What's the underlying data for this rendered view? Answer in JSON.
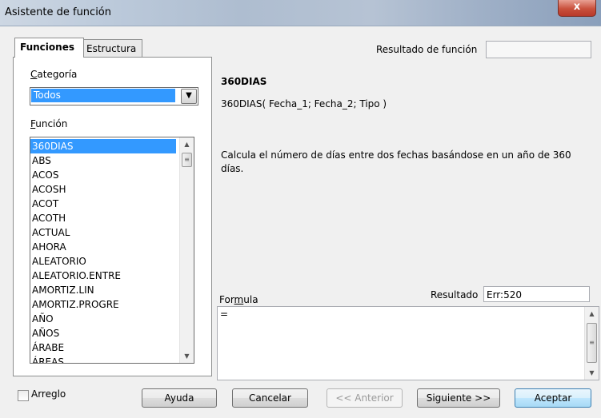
{
  "window": {
    "title": "Asistente de función",
    "close_symbol": "x"
  },
  "tabs": [
    {
      "label": "Funciones",
      "active": true
    },
    {
      "label": "Estructura",
      "active": false
    }
  ],
  "category": {
    "label": "Categoría",
    "selected": "Todos"
  },
  "function_list": {
    "label": "Función",
    "items": [
      "360DIAS",
      "ABS",
      "ACOS",
      "ACOSH",
      "ACOT",
      "ACOTH",
      "ACTUAL",
      "AHORA",
      "ALEATORIO",
      "ALEATORIO.ENTRE",
      "AMORTIZ.LIN",
      "AMORTIZ.PROGRE",
      "AÑO",
      "AÑOS",
      "ÁRABE",
      "ÁREAS"
    ],
    "selected_index": 0
  },
  "function_result": {
    "label": "Resultado de función",
    "value": ""
  },
  "function_info": {
    "name": "360DIAS",
    "syntax": "360DIAS( Fecha_1; Fecha_2; Tipo )",
    "description": "Calcula el número de días entre dos fechas basándose en un año de 360 días."
  },
  "formula": {
    "label": "Formula",
    "value": "="
  },
  "result": {
    "label": "Resultado",
    "value": "Err:520"
  },
  "array_checkbox": {
    "label": "Arreglo",
    "checked": false
  },
  "buttons": {
    "help": "Ayuda",
    "cancel": "Cancelar",
    "previous": "<< Anterior",
    "next": "Siguiente >>",
    "ok": "Aceptar"
  }
}
